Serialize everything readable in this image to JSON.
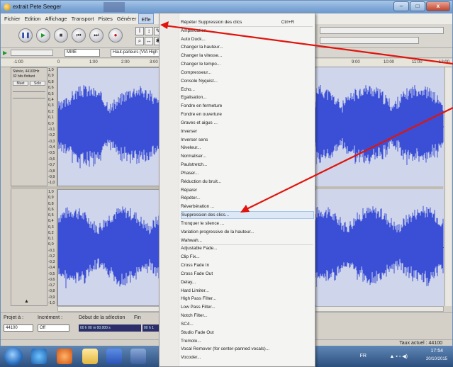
{
  "window": {
    "title": "extrait Pete Seeger"
  },
  "menubar": {
    "items": [
      "Fichier",
      "Edition",
      "Affichage",
      "Transport",
      "Pistes",
      "Générer",
      "Effe"
    ]
  },
  "toolbar": {
    "device_select": "MME",
    "output_select": "Haut-parleurs (VIA High"
  },
  "ruler": {
    "ticks": [
      "-1:00",
      "0",
      "1:00",
      "2:00",
      "3:00",
      "9:00",
      "10:00",
      "11:00",
      "12:00"
    ]
  },
  "tracks": [
    {
      "info": [
        "Stéréo, 44100Hz",
        "32 bits flottant"
      ],
      "mute": "Muet",
      "solo": "Solo",
      "scale": [
        "1,0",
        "0,9",
        "0,8",
        "0,6",
        "0,5",
        "0,4",
        "0,3",
        "0,2",
        "0,1",
        "0,0",
        "-0,1",
        "-0,2",
        "-0,3",
        "-0,4",
        "-0,5",
        "-0,6",
        "-0,7",
        "-0,8",
        "-0,9",
        "-1,0"
      ]
    },
    {
      "scale": [
        "1,0",
        "0,9",
        "0,8",
        "0,6",
        "0,5",
        "0,4",
        "0,3",
        "0,2",
        "0,1",
        "0,0",
        "-0,1",
        "-0,2",
        "-0,3",
        "-0,4",
        "-0,5",
        "-0,6",
        "-0,7",
        "-0,8",
        "-0,9",
        "-1,0"
      ]
    }
  ],
  "selection_bar": {
    "project_label": "Projet à :",
    "project_rate": "44100",
    "snap_label": "Incrément :",
    "snap_value": "Off",
    "start_label": "Début de la sélection",
    "end_label": "Fin",
    "start_time": "00 h 00 m 00,000 s",
    "end_time": "00 h 1"
  },
  "status": {
    "rate": "Taux actuel : 44100"
  },
  "taskbar": {
    "lang": "FR",
    "time": "17:54",
    "date": "20/10/2015"
  },
  "effect_menu": {
    "items": [
      {
        "label": "Répéter Suppression des clics",
        "shortcut": "Ctrl+R"
      },
      {
        "label": "Amplification..."
      },
      {
        "label": "Auto Duck..."
      },
      {
        "label": "Changer la hauteur..."
      },
      {
        "label": "Changer la vitesse..."
      },
      {
        "label": "Changer le tempo..."
      },
      {
        "label": "Compresseur..."
      },
      {
        "label": "Console Nyquist..."
      },
      {
        "label": "Echo..."
      },
      {
        "label": "Egalisation..."
      },
      {
        "label": "Fondre en fermeture"
      },
      {
        "label": "Fondre en ouverture"
      },
      {
        "label": "Graves et aigus ..."
      },
      {
        "label": "Inverser"
      },
      {
        "label": "Inverser sens"
      },
      {
        "label": "Niveleur..."
      },
      {
        "label": "Normaliser..."
      },
      {
        "label": "Paulstretch..."
      },
      {
        "label": "Phaser..."
      },
      {
        "label": "Réduction du bruit..."
      },
      {
        "label": "Réparer"
      },
      {
        "label": "Répéter..."
      },
      {
        "label": "Réverbération ..."
      },
      {
        "label": "Suppression des clics...",
        "highlighted": true
      },
      {
        "label": "Tronquer le silence ..."
      },
      {
        "label": "Variation progressive de la hauteur..."
      },
      {
        "label": "Wahwah..."
      },
      {
        "label": "Adjustable Fade..."
      },
      {
        "label": "Clip Fix..."
      },
      {
        "label": "Cross Fade In"
      },
      {
        "label": "Cross Fade Out"
      },
      {
        "label": "Delay..."
      },
      {
        "label": "Hard Limiter..."
      },
      {
        "label": "High Pass Filter..."
      },
      {
        "label": "Low Pass Filter..."
      },
      {
        "label": "Notch Filter..."
      },
      {
        "label": "SC4..."
      },
      {
        "label": "Studio Fade Out"
      },
      {
        "label": "Tremolo..."
      },
      {
        "label": "Vocal Remover (for center-panned vocals)..."
      },
      {
        "label": "Vocoder..."
      }
    ]
  },
  "colors": {
    "waveform": "#3b4fd6",
    "track_bg": "#cfd5ea",
    "annotation_arrow": "#e0140c"
  }
}
